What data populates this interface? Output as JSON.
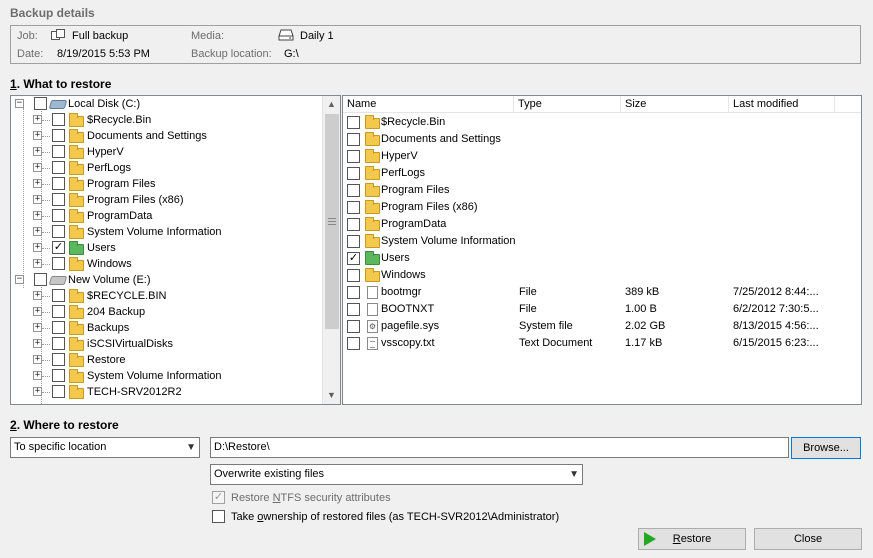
{
  "header": {
    "title": "Backup details",
    "job_label": "Job:",
    "job_value": "Full backup",
    "date_label": "Date:",
    "date_value": "8/19/2015 5:53 PM",
    "media_label": "Media:",
    "media_value": "Daily 1",
    "location_label": "Backup location:",
    "location_value": "G:\\"
  },
  "what_to_restore": {
    "title_key": "1",
    "title_rest": ". What to restore",
    "tree": [
      {
        "label": "Local Disk (C:)",
        "level": 0,
        "type": "drive",
        "expanded": true,
        "checked": false
      },
      {
        "label": "$Recycle.Bin",
        "level": 1,
        "type": "folder",
        "checked": false
      },
      {
        "label": "Documents and Settings",
        "level": 1,
        "type": "folder",
        "checked": false
      },
      {
        "label": "HyperV",
        "level": 1,
        "type": "folder",
        "checked": false
      },
      {
        "label": "PerfLogs",
        "level": 1,
        "type": "folder",
        "checked": false
      },
      {
        "label": "Program Files",
        "level": 1,
        "type": "folder",
        "checked": false
      },
      {
        "label": "Program Files (x86)",
        "level": 1,
        "type": "folder",
        "checked": false
      },
      {
        "label": "ProgramData",
        "level": 1,
        "type": "folder",
        "checked": false
      },
      {
        "label": "System Volume Information",
        "level": 1,
        "type": "folder",
        "checked": false
      },
      {
        "label": "Users",
        "level": 1,
        "type": "folder",
        "checked": true
      },
      {
        "label": "Windows",
        "level": 1,
        "type": "folder",
        "checked": false
      },
      {
        "label": "New Volume (E:)",
        "level": 0,
        "type": "drive",
        "expanded": true,
        "checked": false
      },
      {
        "label": "$RECYCLE.BIN",
        "level": 1,
        "type": "folder",
        "checked": false
      },
      {
        "label": "204 Backup",
        "level": 1,
        "type": "folder",
        "checked": false
      },
      {
        "label": "Backups",
        "level": 1,
        "type": "folder",
        "checked": false
      },
      {
        "label": "iSCSIVirtualDisks",
        "level": 1,
        "type": "folder",
        "checked": false
      },
      {
        "label": "Restore",
        "level": 1,
        "type": "folder",
        "checked": false
      },
      {
        "label": "System Volume Information",
        "level": 1,
        "type": "folder",
        "checked": false
      },
      {
        "label": "TECH-SRV2012R2",
        "level": 1,
        "type": "folder",
        "checked": false
      }
    ],
    "columns": [
      "Name",
      "Type",
      "Size",
      "Last modified"
    ],
    "files": [
      {
        "name": "$Recycle.Bin",
        "type": "",
        "size": "",
        "modified": "",
        "kind": "folder",
        "checked": false
      },
      {
        "name": "Documents and Settings",
        "type": "",
        "size": "",
        "modified": "",
        "kind": "folder",
        "checked": false
      },
      {
        "name": "HyperV",
        "type": "",
        "size": "",
        "modified": "",
        "kind": "folder",
        "checked": false
      },
      {
        "name": "PerfLogs",
        "type": "",
        "size": "",
        "modified": "",
        "kind": "folder",
        "checked": false
      },
      {
        "name": "Program Files",
        "type": "",
        "size": "",
        "modified": "",
        "kind": "folder",
        "checked": false
      },
      {
        "name": "Program Files (x86)",
        "type": "",
        "size": "",
        "modified": "",
        "kind": "folder",
        "checked": false
      },
      {
        "name": "ProgramData",
        "type": "",
        "size": "",
        "modified": "",
        "kind": "folder",
        "checked": false
      },
      {
        "name": "System Volume Information",
        "type": "",
        "size": "",
        "modified": "",
        "kind": "folder",
        "checked": false
      },
      {
        "name": "Users",
        "type": "",
        "size": "",
        "modified": "",
        "kind": "folder-green",
        "checked": true
      },
      {
        "name": "Windows",
        "type": "",
        "size": "",
        "modified": "",
        "kind": "folder",
        "checked": false
      },
      {
        "name": "bootmgr",
        "type": "File",
        "size": "389 kB",
        "modified": "7/25/2012 8:44:...",
        "kind": "file",
        "checked": false
      },
      {
        "name": "BOOTNXT",
        "type": "File",
        "size": "1.00 B",
        "modified": "6/2/2012 7:30:5...",
        "kind": "file",
        "checked": false
      },
      {
        "name": "pagefile.sys",
        "type": "System file",
        "size": "2.02 GB",
        "modified": "8/13/2015 4:56:...",
        "kind": "sys",
        "checked": false
      },
      {
        "name": "vsscopy.txt",
        "type": "Text Document",
        "size": "1.17 kB",
        "modified": "6/15/2015 6:23:...",
        "kind": "txt",
        "checked": false
      }
    ]
  },
  "where_to_restore": {
    "title_key": "2",
    "title_rest": ". Where to restore",
    "location_mode": "To specific location",
    "path": "D:\\Restore\\",
    "browse_label": "Browse...",
    "overwrite_option": "Overwrite existing files",
    "ntfs_pre": "Restore ",
    "ntfs_key": "N",
    "ntfs_post": "TFS security attributes",
    "ntfs_checked": true,
    "ownership_pre": "Take ",
    "ownership_key": "o",
    "ownership_post": "wnership of restored files (as TECH-SVR2012\\Administrator)",
    "ownership_checked": false
  },
  "actions": {
    "restore_key": "R",
    "restore_rest": "estore",
    "close_label": "Close"
  },
  "icons": {
    "job": "job-icon",
    "media": "drive-icon",
    "play": "play-icon"
  }
}
